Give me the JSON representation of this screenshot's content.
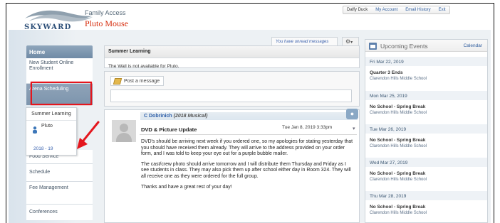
{
  "header": {
    "logo_text": "SKYWARD",
    "app_title": "Family Access",
    "student": "Pluto Mouse",
    "user": "Daffy Duck",
    "links": [
      "My Account",
      "Email History",
      "Exit"
    ]
  },
  "sidebar": {
    "home": "Home",
    "items": [
      "New Student Online Enrollment",
      "Arena Scheduling",
      "Food Service",
      "Schedule",
      "Fee Management",
      "Conferences"
    ]
  },
  "popup": {
    "title": "Summer Learning",
    "student": "Pluto",
    "year": "2018 - 19"
  },
  "notice": {
    "unread": "You have unread messages",
    "gear": "⚙",
    "dropdown": "▾"
  },
  "summer": {
    "title": "Summer Learning",
    "text": "The Wall is not available for Pluto."
  },
  "post": {
    "label": "Post a message"
  },
  "message": {
    "author": "C Dobrinich",
    "group": "(2018 Musical)",
    "title": "DVD & Picture Update",
    "date": "Tue Jan 8, 2019 3:33pm",
    "paragraphs": [
      "DVD's should be arriving next week if you ordered one, so my apologies for stating yesterday that you should have received them already. They will arrive to the address provided on your order form, and I was told to keep your eye out for a purple bubble mailer.",
      "The cast/crew photo should arrive tomorrow and I will distribute them Thursday and Friday as I see students in class. They may also pick them up after school either day in Room 324. They will all receive one as they were ordered for the full group.",
      "Thanks and have a great rest of your day!"
    ]
  },
  "events": {
    "title": "Upcoming Events",
    "calendar": "Calendar",
    "items": [
      {
        "date": "Fri Mar 22, 2019",
        "title": "Quarter 3 Ends",
        "school": "Clarendon Hills Middle School"
      },
      {
        "date": "Mon Mar 25, 2019",
        "title": "No School - Spring Break",
        "school": "Clarendon Hills Middle School"
      },
      {
        "date": "Tue Mar 26, 2019",
        "title": "No School - Spring Break",
        "school": "Clarendon Hills Middle School"
      },
      {
        "date": "Wed Mar 27, 2019",
        "title": "No School - Spring Break",
        "school": "Clarendon Hills Middle School"
      },
      {
        "date": "Thu Mar 28, 2019",
        "title": "No School - Spring Break",
        "school": "Clarendon Hills Middle School"
      }
    ]
  },
  "colors": {
    "accent_red": "#d62b0b",
    "highlight_red": "#e4161d",
    "nav_blue": "#7d95ad",
    "link_blue": "#2f5d9e"
  }
}
